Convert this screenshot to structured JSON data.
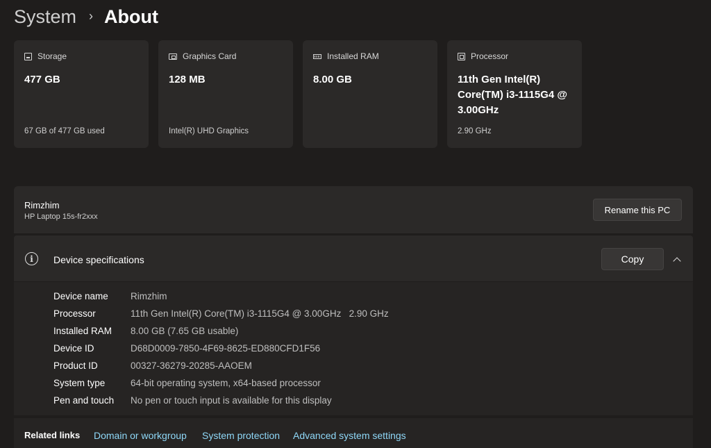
{
  "breadcrumb": {
    "parent": "System",
    "separator": "›",
    "current": "About"
  },
  "cards": [
    {
      "label": "Storage",
      "icon": "storage-icon",
      "value": "477 GB",
      "sub": "67 GB of 477 GB used"
    },
    {
      "label": "Graphics Card",
      "icon": "graphics-card-icon",
      "value": "128 MB",
      "sub": "Intel(R) UHD Graphics"
    },
    {
      "label": "Installed RAM",
      "icon": "ram-icon",
      "value": "8.00 GB",
      "sub": ""
    },
    {
      "label": "Processor",
      "icon": "processor-icon",
      "value": "11th Gen Intel(R) Core(TM) i3-1115G4 @ 3.00GHz",
      "sub": "2.90 GHz"
    }
  ],
  "pc": {
    "name": "Rimzhim",
    "model": "HP Laptop 15s-fr2xxx",
    "rename_label": "Rename this PC"
  },
  "specs": {
    "title": "Device specifications",
    "info_icon": "i",
    "copy_label": "Copy",
    "rows": [
      {
        "label": "Device name",
        "value": "Rimzhim"
      },
      {
        "label": "Processor",
        "value": "11th Gen Intel(R) Core(TM) i3-1115G4 @ 3.00GHz   2.90 GHz"
      },
      {
        "label": "Installed RAM",
        "value": "8.00 GB (7.65 GB usable)"
      },
      {
        "label": "Device ID",
        "value": "D68D0009-7850-4F69-8625-ED880CFD1F56"
      },
      {
        "label": "Product ID",
        "value": "00327-36279-20285-AAOEM"
      },
      {
        "label": "System type",
        "value": "64-bit operating system, x64-based processor"
      },
      {
        "label": "Pen and touch",
        "value": "No pen or touch input is available for this display"
      }
    ]
  },
  "related": {
    "title": "Related links",
    "links": [
      "Domain or workgroup",
      "System protection",
      "Advanced system settings"
    ]
  },
  "colors": {
    "background": "#1f1d1c",
    "card": "#2b2928",
    "link": "#8fd8f8"
  }
}
